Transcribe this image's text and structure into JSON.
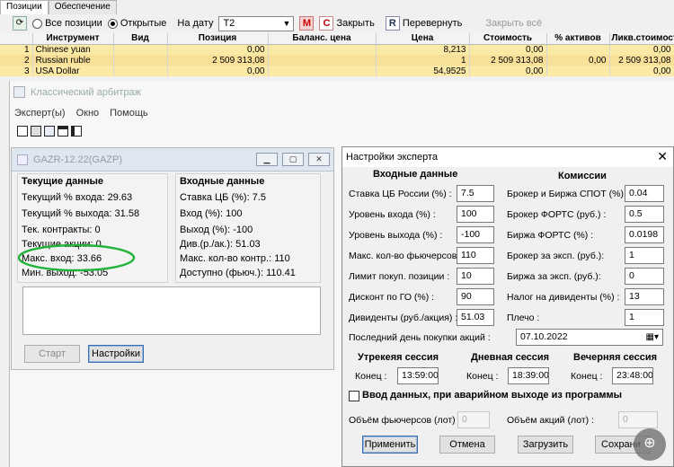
{
  "top": {
    "tabs": [
      "Позиции",
      "Обеспечение"
    ],
    "toolbar": {
      "radio_all": "Все позиции",
      "radio_open": "Открытые",
      "date_label": "На дату",
      "date_value": "T2",
      "m_label": "M",
      "close_letter": "C",
      "close_label": "Закрыть",
      "flip_letter": "R",
      "flip_label": "Перевернуть",
      "close_all_label": "Закрыть всё"
    },
    "columns": [
      "Инструмент",
      "Вид",
      "Позиция",
      "Баланс. цена",
      "Цена",
      "Стоимость",
      "% активов",
      "Ликв.стоимость"
    ],
    "rows": [
      {
        "n": "1",
        "instrument": "Chinese yuan",
        "view": "",
        "position": "0,00",
        "balance": "",
        "price": "8,213",
        "value": "0,00",
        "assets": "",
        "liquid": "0,00"
      },
      {
        "n": "2",
        "instrument": "Russian ruble",
        "view": "",
        "position": "2 509 313,08",
        "balance": "",
        "price": "1",
        "value": "2 509 313,08",
        "assets": "0,00",
        "liquid": "2 509 313,08"
      },
      {
        "n": "3",
        "instrument": "USA Dollar",
        "view": "",
        "position": "0,00",
        "balance": "",
        "price": "54,9525",
        "value": "0,00",
        "assets": "",
        "liquid": "0,00"
      }
    ]
  },
  "arb": {
    "title": "Классический арбитраж",
    "menu": [
      "Эксперт(ы)",
      "Окно",
      "Помощь"
    ]
  },
  "gazr": {
    "title": "GAZR-12.22(GAZP)",
    "current": {
      "header": "Текущие данные",
      "lines": [
        "Текущий % входа: 29.63",
        "Текущий % выхода: 31.58",
        "Тек. контракты: 0",
        "Текущие акции: 0",
        "Макс. вход: 33.66",
        "Мин. выход: -53.05"
      ]
    },
    "input": {
      "header": "Входные данные",
      "lines": [
        "Ставка ЦБ (%): 7.5",
        "Вход (%): 100",
        "Выход (%): -100",
        "Див.(р./ак.): 51.03",
        "Макс. кол-во контр.: 110",
        "Доступно (фьюч.): 110.41"
      ]
    },
    "start_label": "Старт",
    "settings_label": "Настройки"
  },
  "dlg": {
    "title": "Настройки эксперта",
    "close": "✕",
    "input_header": "Входные данные",
    "commission_header": "Комиссии",
    "left": [
      {
        "label": "Ставка ЦБ России (%) :",
        "value": "7.5"
      },
      {
        "label": "Уровень входа (%) :",
        "value": "100"
      },
      {
        "label": "Уровень выхода (%) :",
        "value": "-100"
      },
      {
        "label": "Макс. кол-во фьючерсов :",
        "value": "110"
      },
      {
        "label": "Лимит покуп. позиции :",
        "value": "10"
      },
      {
        "label": "Дисконт по ГО (%) :",
        "value": "90"
      },
      {
        "label": "Дивиденты (руб./акция) :",
        "value": "51.03"
      }
    ],
    "right": [
      {
        "label": "Брокер и Биржа СПОТ (%):",
        "value": "0.04"
      },
      {
        "label": "Брокер ФОРТС (руб.) :",
        "value": "0.5"
      },
      {
        "label": "Биржа ФОРТС (%) :",
        "value": "0.0198"
      },
      {
        "label": "Брокер за эксп. (руб.):",
        "value": "1"
      },
      {
        "label": "Биржа за эксп. (руб.):",
        "value": "0"
      },
      {
        "label": "Налог на дивиденты (%) :",
        "value": "13"
      },
      {
        "label": "Плечо :",
        "value": "1"
      }
    ],
    "last_day_label": "Последний день покупки акций :",
    "last_day_value": "07.10.2022",
    "sessions": [
      {
        "title": "Утрекеяя сессия",
        "end_label": "Конец :",
        "end_value": "13:59:00"
      },
      {
        "title": "Дневная сессия",
        "end_label": "Конец :",
        "end_value": "18:39:00"
      },
      {
        "title": "Вечерняя сессия",
        "end_label": "Конец :",
        "end_value": "23:48:00"
      }
    ],
    "emergency_label": "Ввод данных, при аварийном выходе из программы",
    "fut_volume_label": "Объём фьючерсов (лот) :",
    "fut_volume_value": "0",
    "shares_volume_label": "Объём акций (лот) :",
    "shares_volume_value": "0",
    "buttons": {
      "apply": "Применить",
      "cancel": "Отмена",
      "load": "Загрузить",
      "save": "Сохрани"
    }
  },
  "zoom_icon": "⊕"
}
